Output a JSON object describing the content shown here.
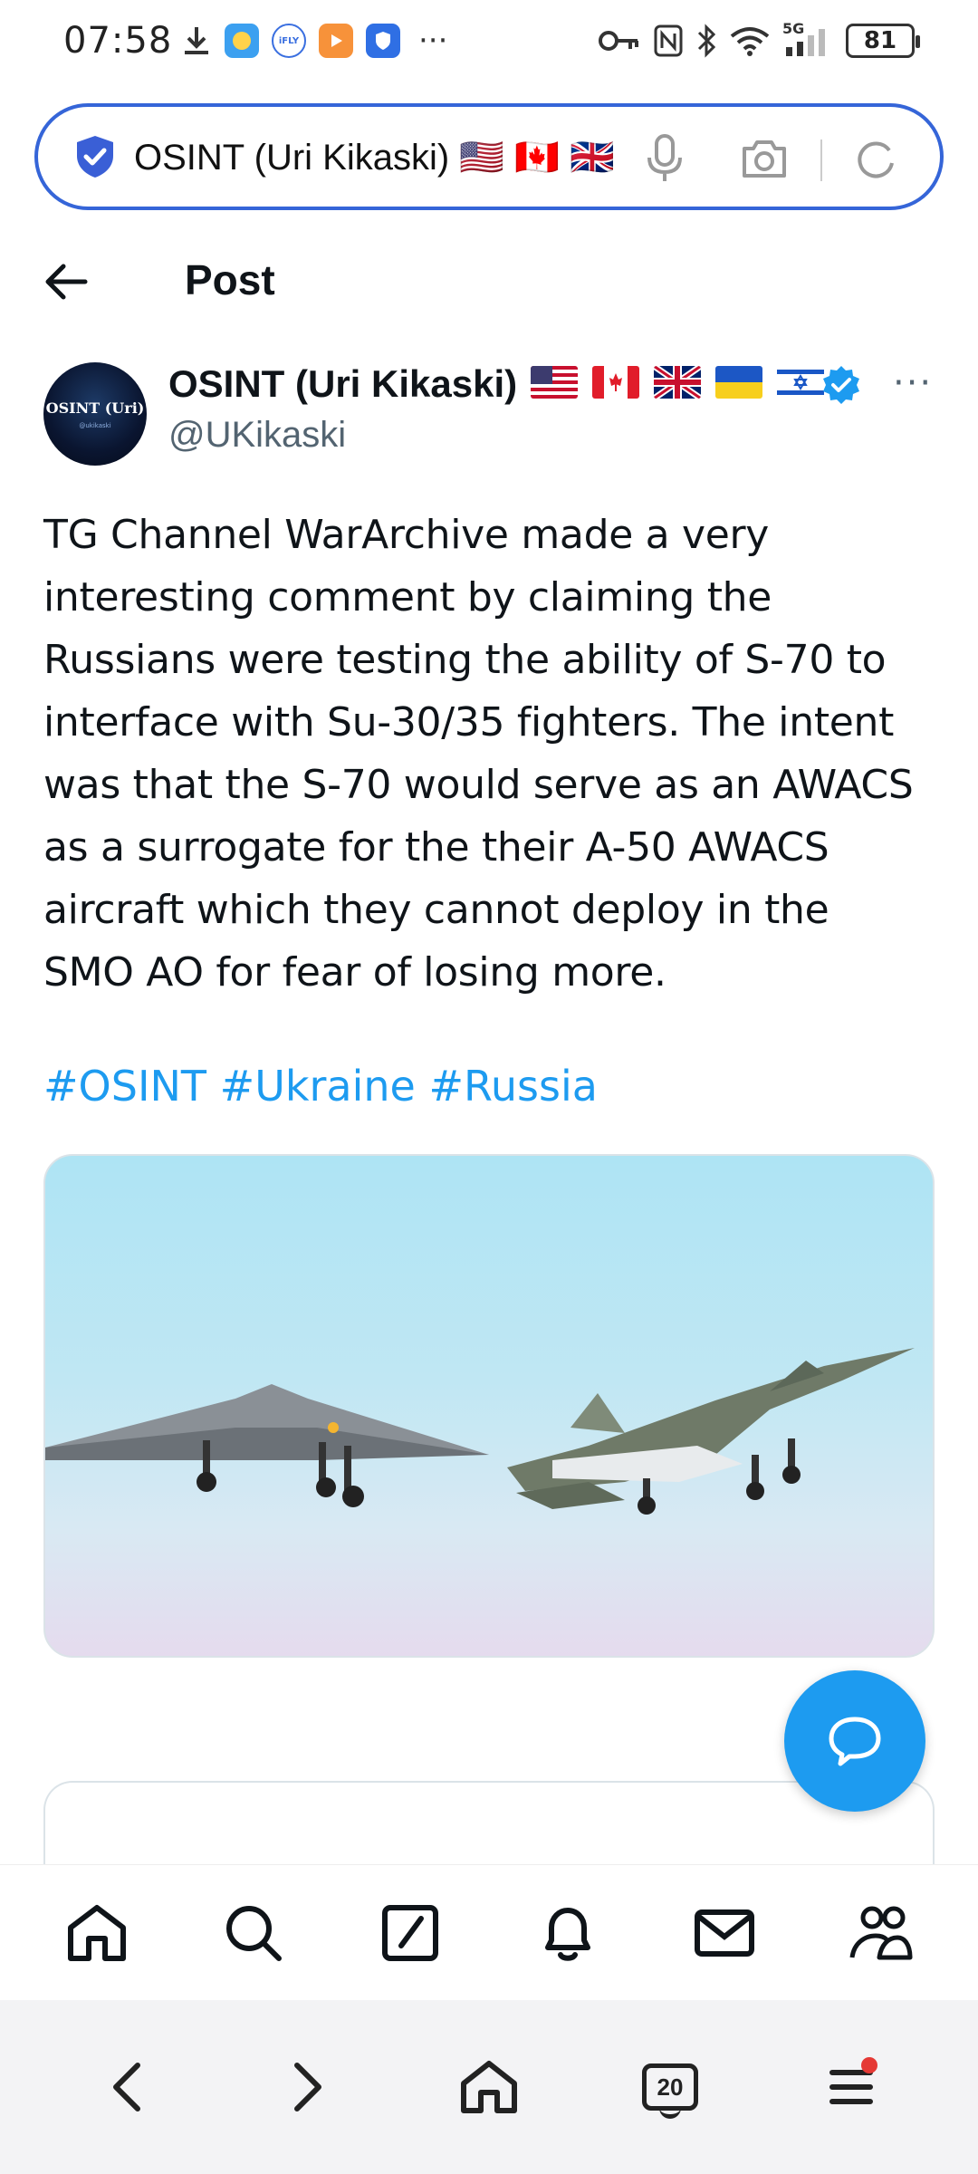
{
  "status_bar": {
    "time": "07:58",
    "network": "5G",
    "battery": "81"
  },
  "address_bar": {
    "text": "OSINT (Uri Kikaski) 🇺🇸 🇨🇦 🇬🇧"
  },
  "header": {
    "title": "Post"
  },
  "author": {
    "name": "OSINT (Uri Kikaski)",
    "handle": "@UKikaski",
    "avatar_text": "OSINT (Uri)",
    "avatar_sub": "@ukikaski"
  },
  "post": {
    "lines": [
      "TG Channel WarArchive made a very",
      "interesting comment by claiming the",
      "Russians were testing the ability of S-70 to",
      "interface with Su-30/35 fighters. The intent",
      "was that the S-70 would serve as an AWACS",
      "as a surrogate for the their A-50 AWACS",
      "aircraft which they cannot deploy in the",
      "SMO AO for fear of losing more."
    ],
    "hashtags": "#OSINT #Ukraine #Russia"
  },
  "browser_nav": {
    "tabs_count": "20"
  },
  "colors": {
    "accent": "#1d9bf0",
    "address_border": "#3565d8",
    "secondary_text": "#536471"
  }
}
